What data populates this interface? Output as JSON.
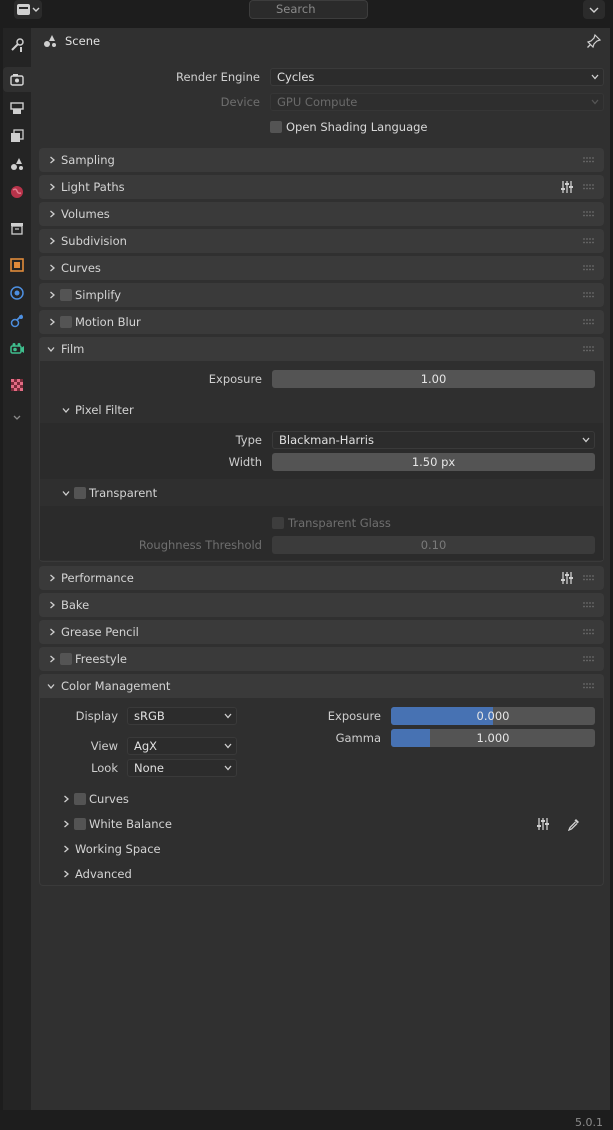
{
  "header": {
    "search_placeholder": "Search"
  },
  "context": {
    "title": "Scene"
  },
  "render": {
    "engine_label": "Render Engine",
    "engine_value": "Cycles",
    "device_label": "Device",
    "device_value": "GPU Compute",
    "osl_label": "Open Shading Language"
  },
  "panels": {
    "sampling": "Sampling",
    "light_paths": "Light Paths",
    "volumes": "Volumes",
    "subdivision": "Subdivision",
    "curves": "Curves",
    "simplify": "Simplify",
    "motion_blur": "Motion Blur",
    "film": "Film",
    "performance": "Performance",
    "bake": "Bake",
    "grease_pencil": "Grease Pencil",
    "freestyle": "Freestyle",
    "color_management": "Color Management"
  },
  "film": {
    "exposure_label": "Exposure",
    "exposure_value": "1.00",
    "pixel_filter": "Pixel Filter",
    "type_label": "Type",
    "type_value": "Blackman-Harris",
    "width_label": "Width",
    "width_value": "1.50 px",
    "transparent": "Transparent",
    "transparent_glass": "Transparent Glass",
    "roughness_label": "Roughness Threshold",
    "roughness_value": "0.10"
  },
  "color_management": {
    "display_label": "Display",
    "display_value": "sRGB",
    "view_label": "View",
    "view_value": "AgX",
    "look_label": "Look",
    "look_value": "None",
    "exposure_label": "Exposure",
    "exposure_value": "0.000",
    "exposure_fill": 0.5,
    "gamma_label": "Gamma",
    "gamma_value": "1.000",
    "gamma_fill": 0.19,
    "curves": "Curves",
    "white_balance": "White Balance",
    "working_space": "Working Space",
    "advanced": "Advanced"
  },
  "footer": {
    "version": "5.0.1"
  },
  "colors": {
    "accent": "#4772b3",
    "panel": "#3a3a3a",
    "background": "#303030"
  },
  "icons": [
    "editor-type-icon",
    "search-icon",
    "tool-icon",
    "render-icon",
    "output-icon",
    "view-layer-icon",
    "scene-icon",
    "world-icon",
    "collection-icon",
    "object-icon",
    "modifier-icon",
    "particles-icon",
    "physics-icon",
    "constraints-icon",
    "data-icon",
    "texture-icon",
    "pin-icon",
    "presets-icon",
    "eyedropper-icon"
  ]
}
